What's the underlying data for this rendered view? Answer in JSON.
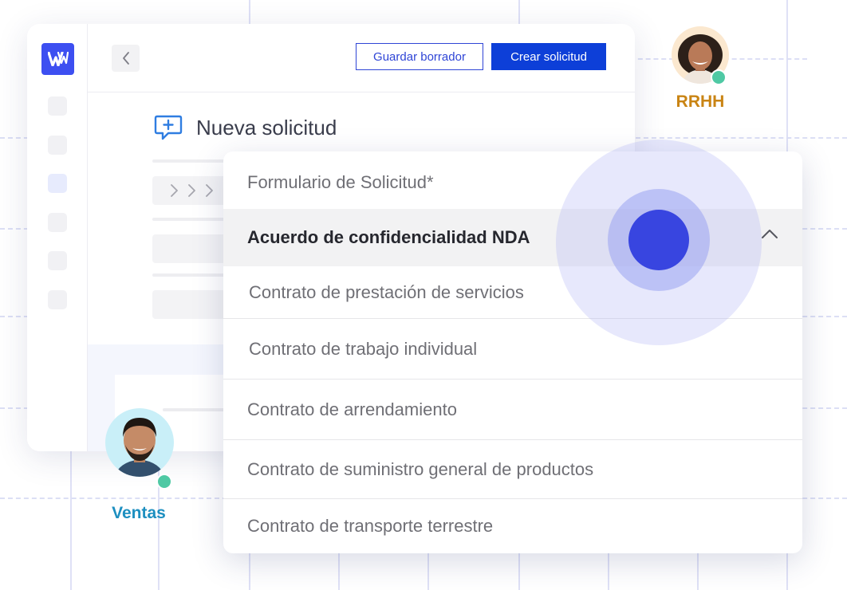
{
  "colors": {
    "accent": "#0d3fd8",
    "logo": "#3d4ff1",
    "ripple": "#3845e0",
    "online_status": "#4fc9a4",
    "rrhh_label": "#c98414",
    "ventas_label": "#1d8fc0"
  },
  "toolbar": {
    "back_icon": "chevron-left-icon",
    "save_draft_label": "Guardar borrador",
    "create_label": "Crear solicitud"
  },
  "sidebar": {
    "logo_icon": "w-logo-icon",
    "items": [
      {
        "active": false
      },
      {
        "active": false
      },
      {
        "active": true
      },
      {
        "active": false
      },
      {
        "active": false
      },
      {
        "active": false
      }
    ]
  },
  "form": {
    "icon": "chat-plus-icon",
    "title": "Nueva solicitud",
    "breadcrumb_icons": "chevron-right-icon"
  },
  "dropdown": {
    "label": "Formulario de Solicitud*",
    "selected": "Acuerdo de confidencialidad NDA",
    "toggle_icon": "chevron-up-icon",
    "options": [
      "Contrato de prestación de servicios",
      "Contrato de trabajo individual",
      "Contrato de arrendamiento",
      "Contrato de suministro general de productos",
      "Contrato de transporte terrestre"
    ]
  },
  "users": {
    "hr": {
      "label": "RRHH",
      "status": "online"
    },
    "sales": {
      "label": "Ventas",
      "status": "online"
    }
  }
}
